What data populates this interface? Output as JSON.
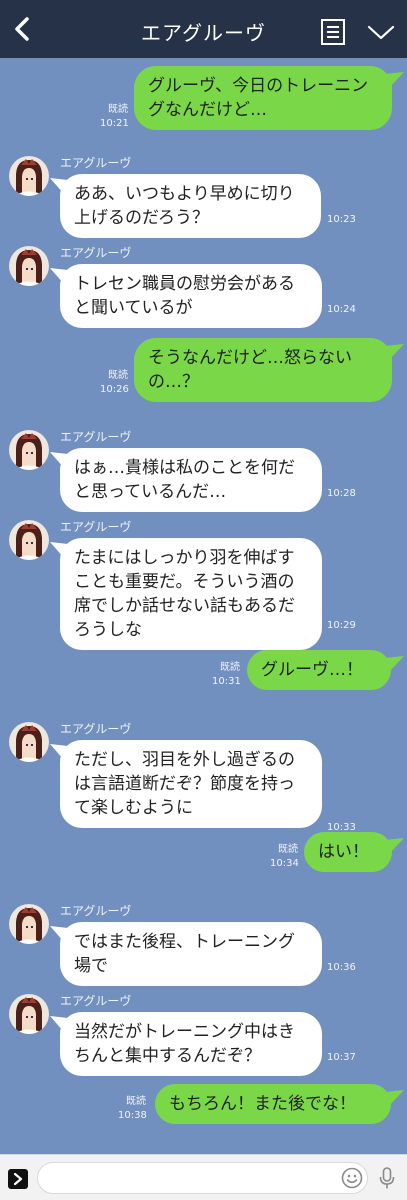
{
  "header": {
    "title": "エアグルーヴ"
  },
  "colors": {
    "background": "#7290bf",
    "header": "#263248",
    "outgoing_bubble": "#7ad848",
    "incoming_bubble": "#ffffff"
  },
  "messages": [
    {
      "dir": "out",
      "text": "グルーヴ、今日のトレーニングなんだけど…",
      "time": "10:21",
      "read": "既読"
    },
    {
      "dir": "in",
      "sender": "エアグルーヴ",
      "text": "ああ、いつもより早めに切り上げるのだろう？",
      "time": "10:23"
    },
    {
      "dir": "in",
      "sender": "エアグルーヴ",
      "text": "トレセン職員の慰労会があると聞いているが",
      "time": "10:24"
    },
    {
      "dir": "out",
      "text": "そうなんだけど…怒らないの…？",
      "time": "10:26",
      "read": "既読"
    },
    {
      "dir": "in",
      "sender": "エアグルーヴ",
      "text": "はぁ…貴様は私のことを何だと思っているんだ…",
      "time": "10:28"
    },
    {
      "dir": "in",
      "sender": "エアグルーヴ",
      "text": "たまにはしっかり羽を伸ばすことも重要だ。そういう酒の席でしか話せない話もあるだろうしな",
      "time": "10:29"
    },
    {
      "dir": "out",
      "text": "グルーヴ…！",
      "time": "10:31",
      "read": "既読"
    },
    {
      "dir": "in",
      "sender": "エアグルーヴ",
      "text": "ただし、羽目を外し過ぎるのは言語道断だぞ？節度を持って楽しむように",
      "time": "10:33"
    },
    {
      "dir": "out",
      "text": "はい！",
      "time": "10:34",
      "read": "既読"
    },
    {
      "dir": "in",
      "sender": "エアグルーヴ",
      "text": "ではまた後程、トレーニング場で",
      "time": "10:36"
    },
    {
      "dir": "in",
      "sender": "エアグルーヴ",
      "text": "当然だがトレーニング中はきちんと集中するんだぞ？",
      "time": "10:37"
    },
    {
      "dir": "out",
      "text": "もちろん！また後でな！",
      "time": "10:38",
      "read": "既読"
    }
  ]
}
